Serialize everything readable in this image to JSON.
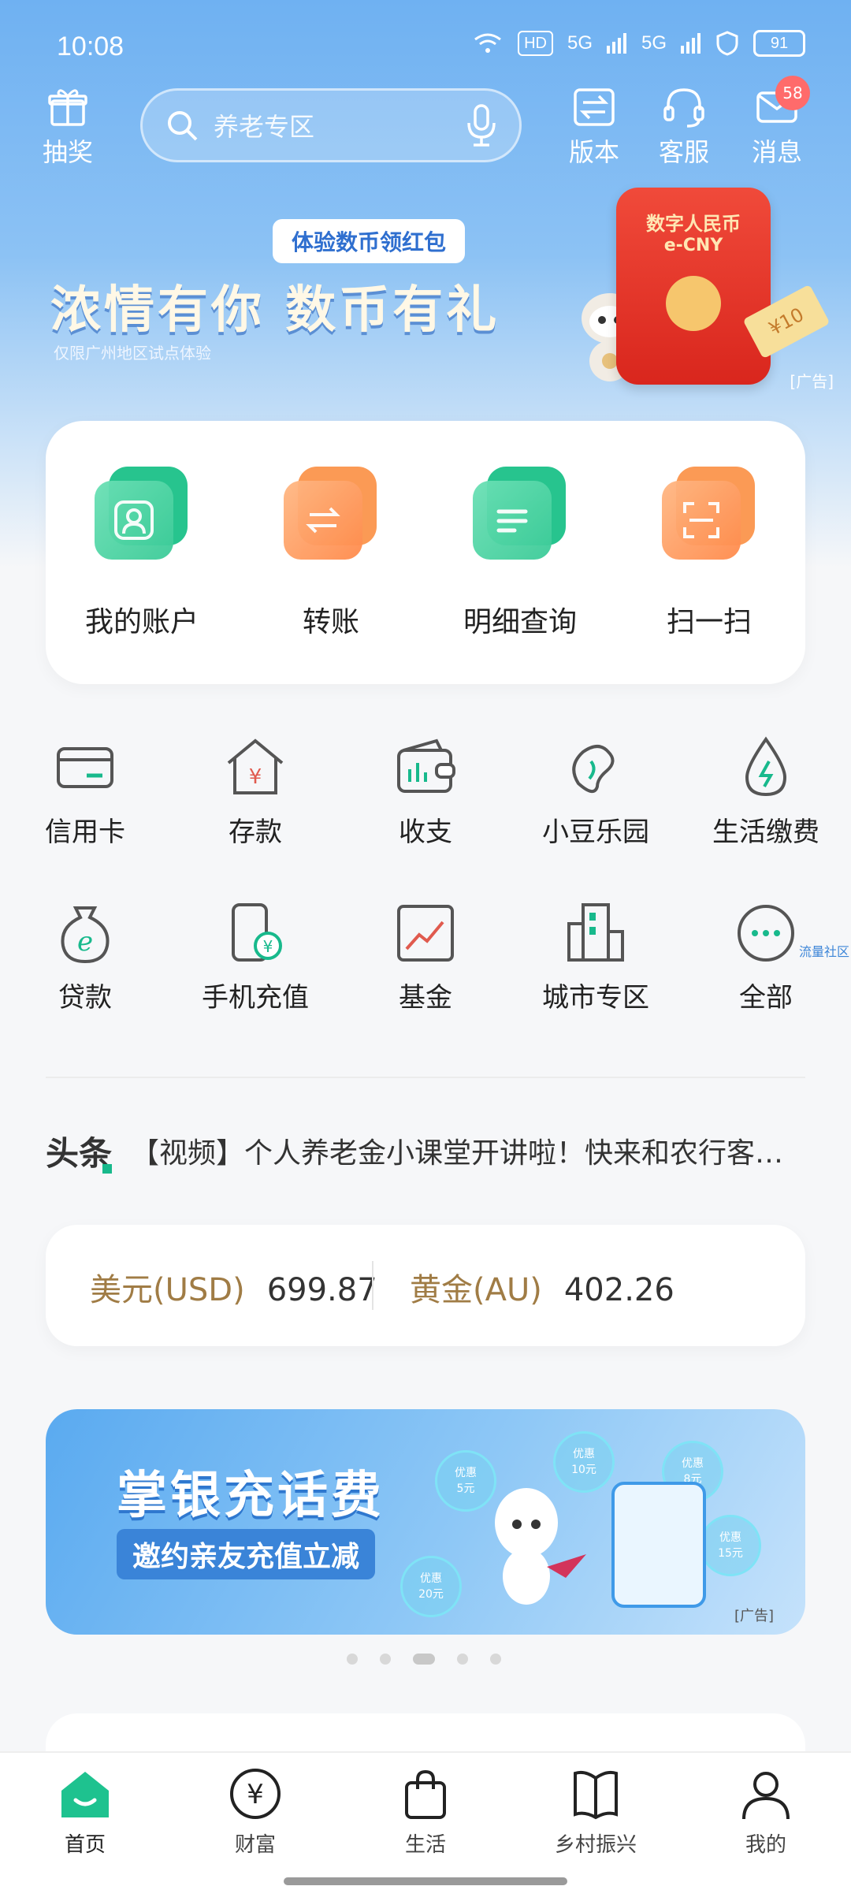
{
  "status_bar": {
    "time": "10:08",
    "hd": "HD",
    "net1": "5G",
    "net2": "5G",
    "battery": "91"
  },
  "header": {
    "lottery_label": "抽奖",
    "search_placeholder": "养老专区",
    "version_label": "版本",
    "service_label": "客服",
    "message_label": "消息",
    "message_badge": "58"
  },
  "banner": {
    "tag": "体验数币领红包",
    "title": "浓情有你 数币有礼",
    "subtitle": "仅限广州地区试点体验",
    "packet_title": "数字人民币",
    "packet_sub": "e-CNY",
    "ticket": "¥10",
    "ad_tag": "[广告]"
  },
  "quick_actions": [
    {
      "label": "我的账户",
      "icon": "account-icon",
      "color": "green"
    },
    {
      "label": "转账",
      "icon": "transfer-icon",
      "color": "orange"
    },
    {
      "label": "明细查询",
      "icon": "details-icon",
      "color": "green"
    },
    {
      "label": "扫一扫",
      "icon": "scan-icon",
      "color": "orange"
    }
  ],
  "services": [
    {
      "label": "信用卡",
      "icon": "credit-card-icon"
    },
    {
      "label": "存款",
      "icon": "deposit-icon"
    },
    {
      "label": "收支",
      "icon": "wallet-icon"
    },
    {
      "label": "小豆乐园",
      "icon": "bean-icon"
    },
    {
      "label": "生活缴费",
      "icon": "utility-icon"
    },
    {
      "label": "贷款",
      "icon": "loan-icon"
    },
    {
      "label": "手机充值",
      "icon": "phone-topup-icon"
    },
    {
      "label": "基金",
      "icon": "fund-icon"
    },
    {
      "label": "城市专区",
      "icon": "city-icon"
    },
    {
      "label": "全部",
      "icon": "more-icon"
    }
  ],
  "side_link": "流量社区",
  "headline": {
    "tag": "头条",
    "text": "【视频】个人养老金小课堂开讲啦！快来和农行客服小…"
  },
  "rates": [
    {
      "name": "美元(USD)",
      "value": "699.87"
    },
    {
      "name": "黄金(AU)",
      "value": "402.26"
    }
  ],
  "ad2": {
    "title": "掌银充话费",
    "subtitle": "邀约亲友充值立减",
    "bubbles": [
      "优惠\n5元",
      "优惠\n10元",
      "优惠\n8元",
      "优惠\n15元",
      "优惠\n20元"
    ],
    "ad_tag": "[广告]"
  },
  "carousel": {
    "count": 5,
    "active_index": 2
  },
  "bottom_nav": [
    {
      "label": "首页",
      "icon": "home-icon",
      "active": true
    },
    {
      "label": "财富",
      "icon": "wealth-icon",
      "active": false
    },
    {
      "label": "生活",
      "icon": "shopping-bag-icon",
      "active": false
    },
    {
      "label": "乡村振兴",
      "icon": "book-icon",
      "active": false
    },
    {
      "label": "我的",
      "icon": "profile-icon",
      "active": false
    }
  ],
  "colors": {
    "accent_green": "#18b98c",
    "accent_orange": "#ff8b4c",
    "gold_text": "#a07c45",
    "header_blue": "#6fb1f2"
  }
}
